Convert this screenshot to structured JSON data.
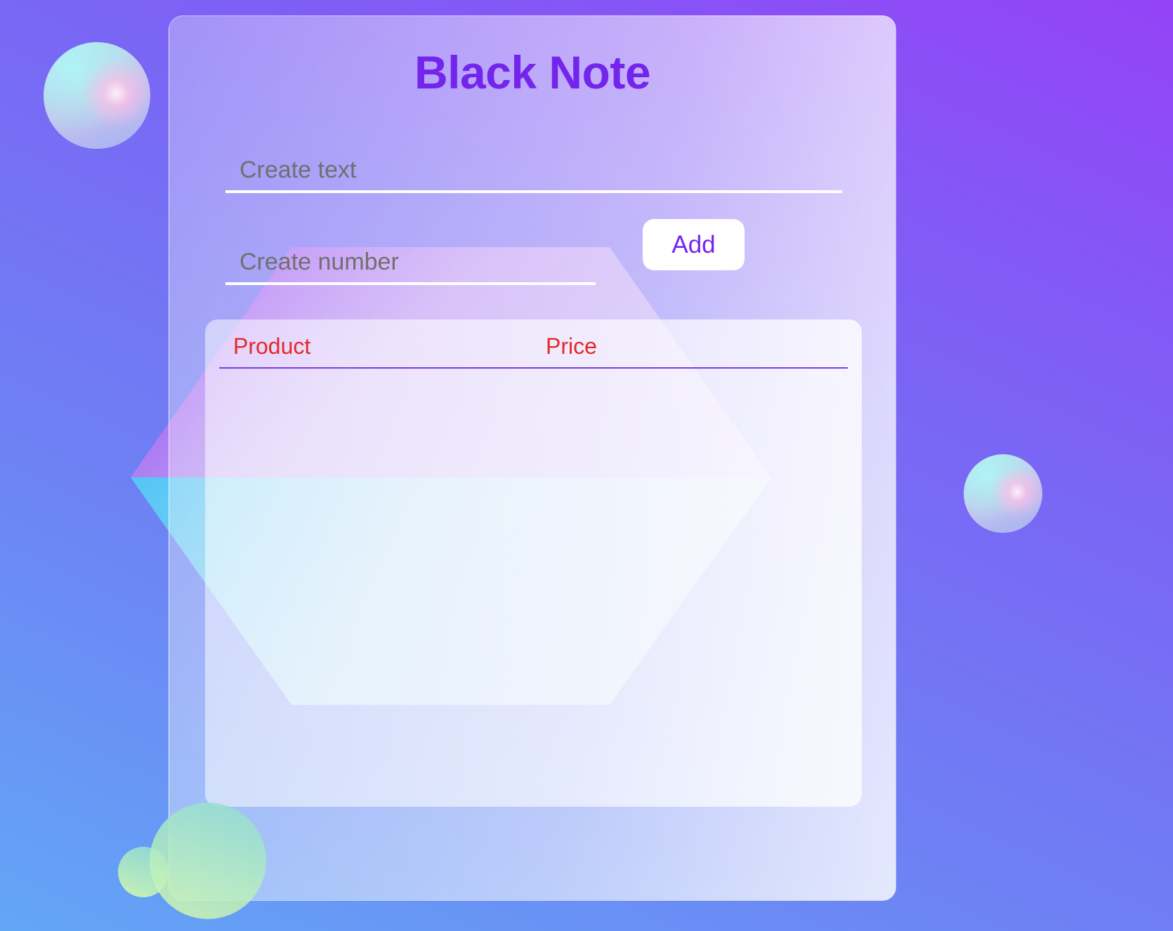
{
  "app": {
    "title": "Black Note"
  },
  "form": {
    "text_placeholder": "Create text",
    "text_value": "",
    "number_placeholder": "Create number",
    "number_value": "",
    "add_label": "Add"
  },
  "table": {
    "headers": [
      "Product",
      "Price"
    ],
    "rows": []
  },
  "colors": {
    "accent": "#7425ec",
    "header_text": "#e32a2a",
    "background_top": "#9443f6",
    "background_bottom": "#63a6f6"
  }
}
